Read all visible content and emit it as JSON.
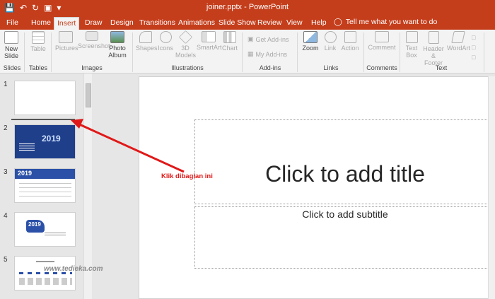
{
  "titlebar": {
    "filename_title": "joiner.pptx - PowerPoint",
    "bg": "#c43e1c"
  },
  "qat": [
    "save-icon",
    "undo-icon",
    "redo-icon",
    "present-icon",
    "customize-icon"
  ],
  "tabs": [
    "File",
    "Home",
    "Insert",
    "Draw",
    "Design",
    "Transitions",
    "Animations",
    "Slide Show",
    "Review",
    "View",
    "Help"
  ],
  "active_tab": "Insert",
  "tell_me": "Tell me what you want to do",
  "ribbon": {
    "slides": {
      "new_slide": "New",
      "new_slide2": "Slide",
      "group": "Slides"
    },
    "tables": {
      "table": "Table",
      "group": "Tables"
    },
    "images": {
      "pictures": "Pictures",
      "screenshot": "Screenshot",
      "photo_album": "Photo",
      "photo_album2": "Album",
      "group": "Images"
    },
    "illustrations": {
      "shapes": "Shapes",
      "icons": "Icons",
      "models": "3D",
      "models2": "Models",
      "smartart": "SmartArt",
      "chart": "Chart",
      "group": "Illustrations"
    },
    "addins": {
      "get_addins": "Get Add-ins",
      "my_addins": "My Add-ins",
      "group": "Add-ins"
    },
    "links": {
      "zoom": "Zoom",
      "link": "Link",
      "action": "Action",
      "group": "Links"
    },
    "comments": {
      "comment": "Comment",
      "group": "Comments"
    },
    "text": {
      "textbox": "Text",
      "textbox2": "Box",
      "header": "Header",
      "header2": "& Footer",
      "wordart": "WordArt",
      "group": "Text"
    }
  },
  "slides": [
    {
      "num": "1"
    },
    {
      "num": "2",
      "year": "2019"
    },
    {
      "num": "3",
      "year": "2019"
    },
    {
      "num": "4",
      "year": "2019"
    },
    {
      "num": "5"
    }
  ],
  "slide": {
    "title_placeholder": "Click to add title",
    "subtitle_placeholder": "Click to add subtitle"
  },
  "annotation": "Klik dibagian ini",
  "watermark": "www.tedieka.com",
  "colors": {
    "accent": "#c43e1c",
    "annotation": "#e01818",
    "thumb_blue": "#1f3f8a"
  }
}
